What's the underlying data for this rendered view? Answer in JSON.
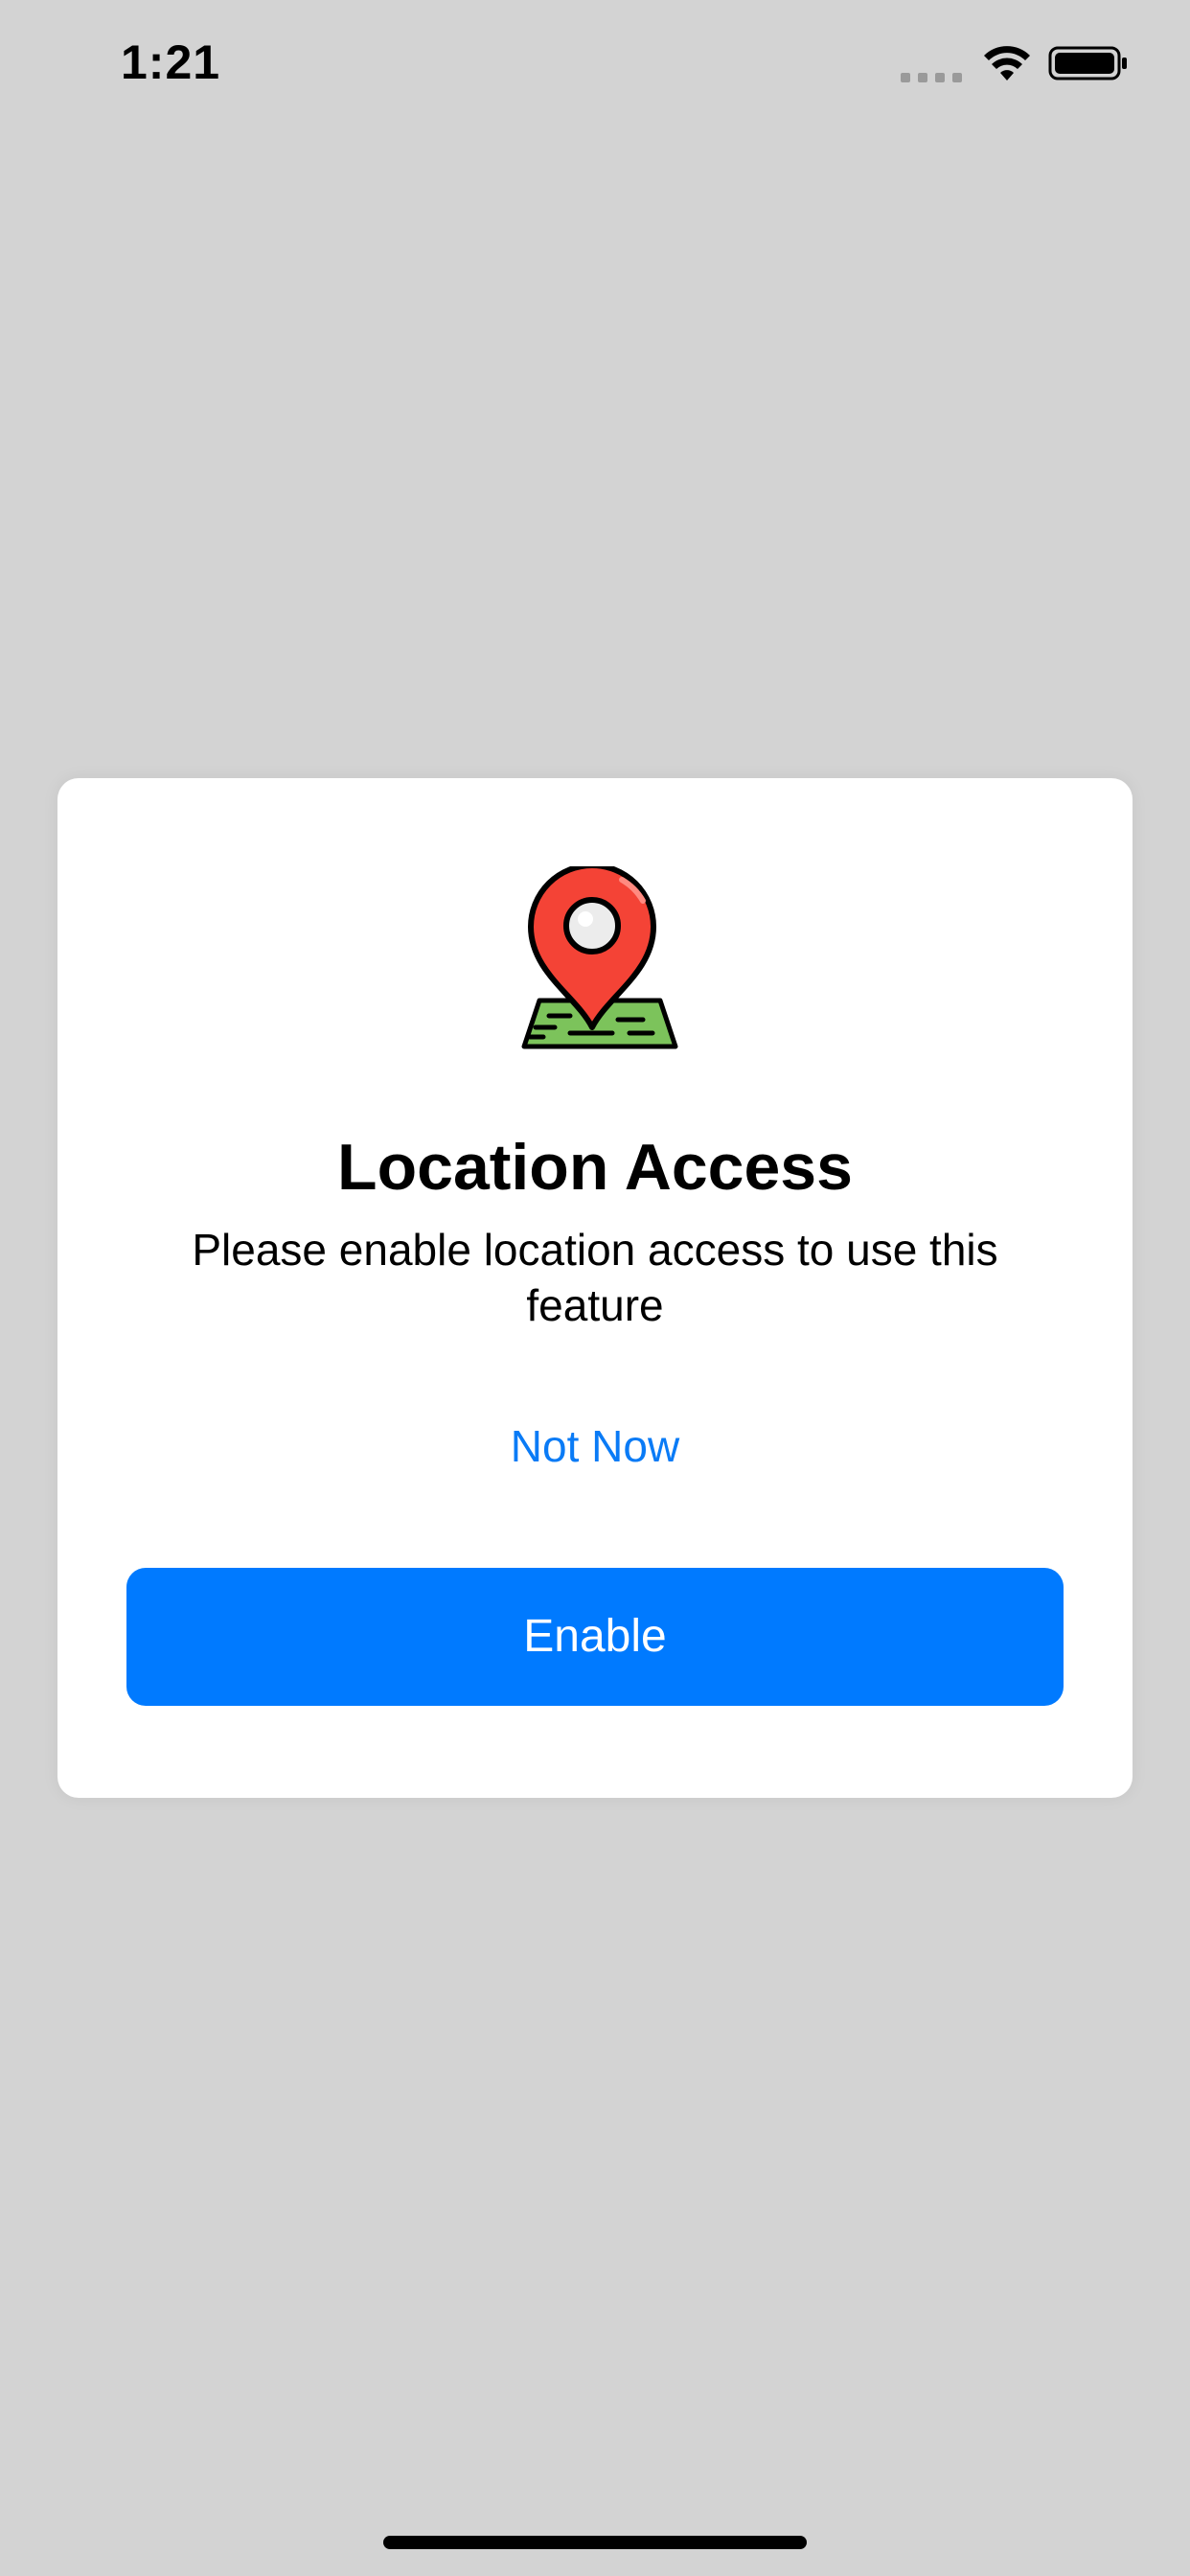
{
  "status_bar": {
    "time": "1:21",
    "icons": [
      "cellular-signal-icon",
      "wifi-icon",
      "battery-icon"
    ]
  },
  "dialog": {
    "icon": "location-pin-map-icon",
    "title": "Location Access",
    "message": "Please enable location access to use this feature",
    "secondary_action": "Not Now",
    "primary_action": "Enable"
  },
  "colors": {
    "background": "#d3d3d3",
    "card": "#ffffff",
    "accent": "#007aff",
    "link": "#0a7bf6",
    "pin_red": "#f44336",
    "map_green": "#7cc35b"
  }
}
